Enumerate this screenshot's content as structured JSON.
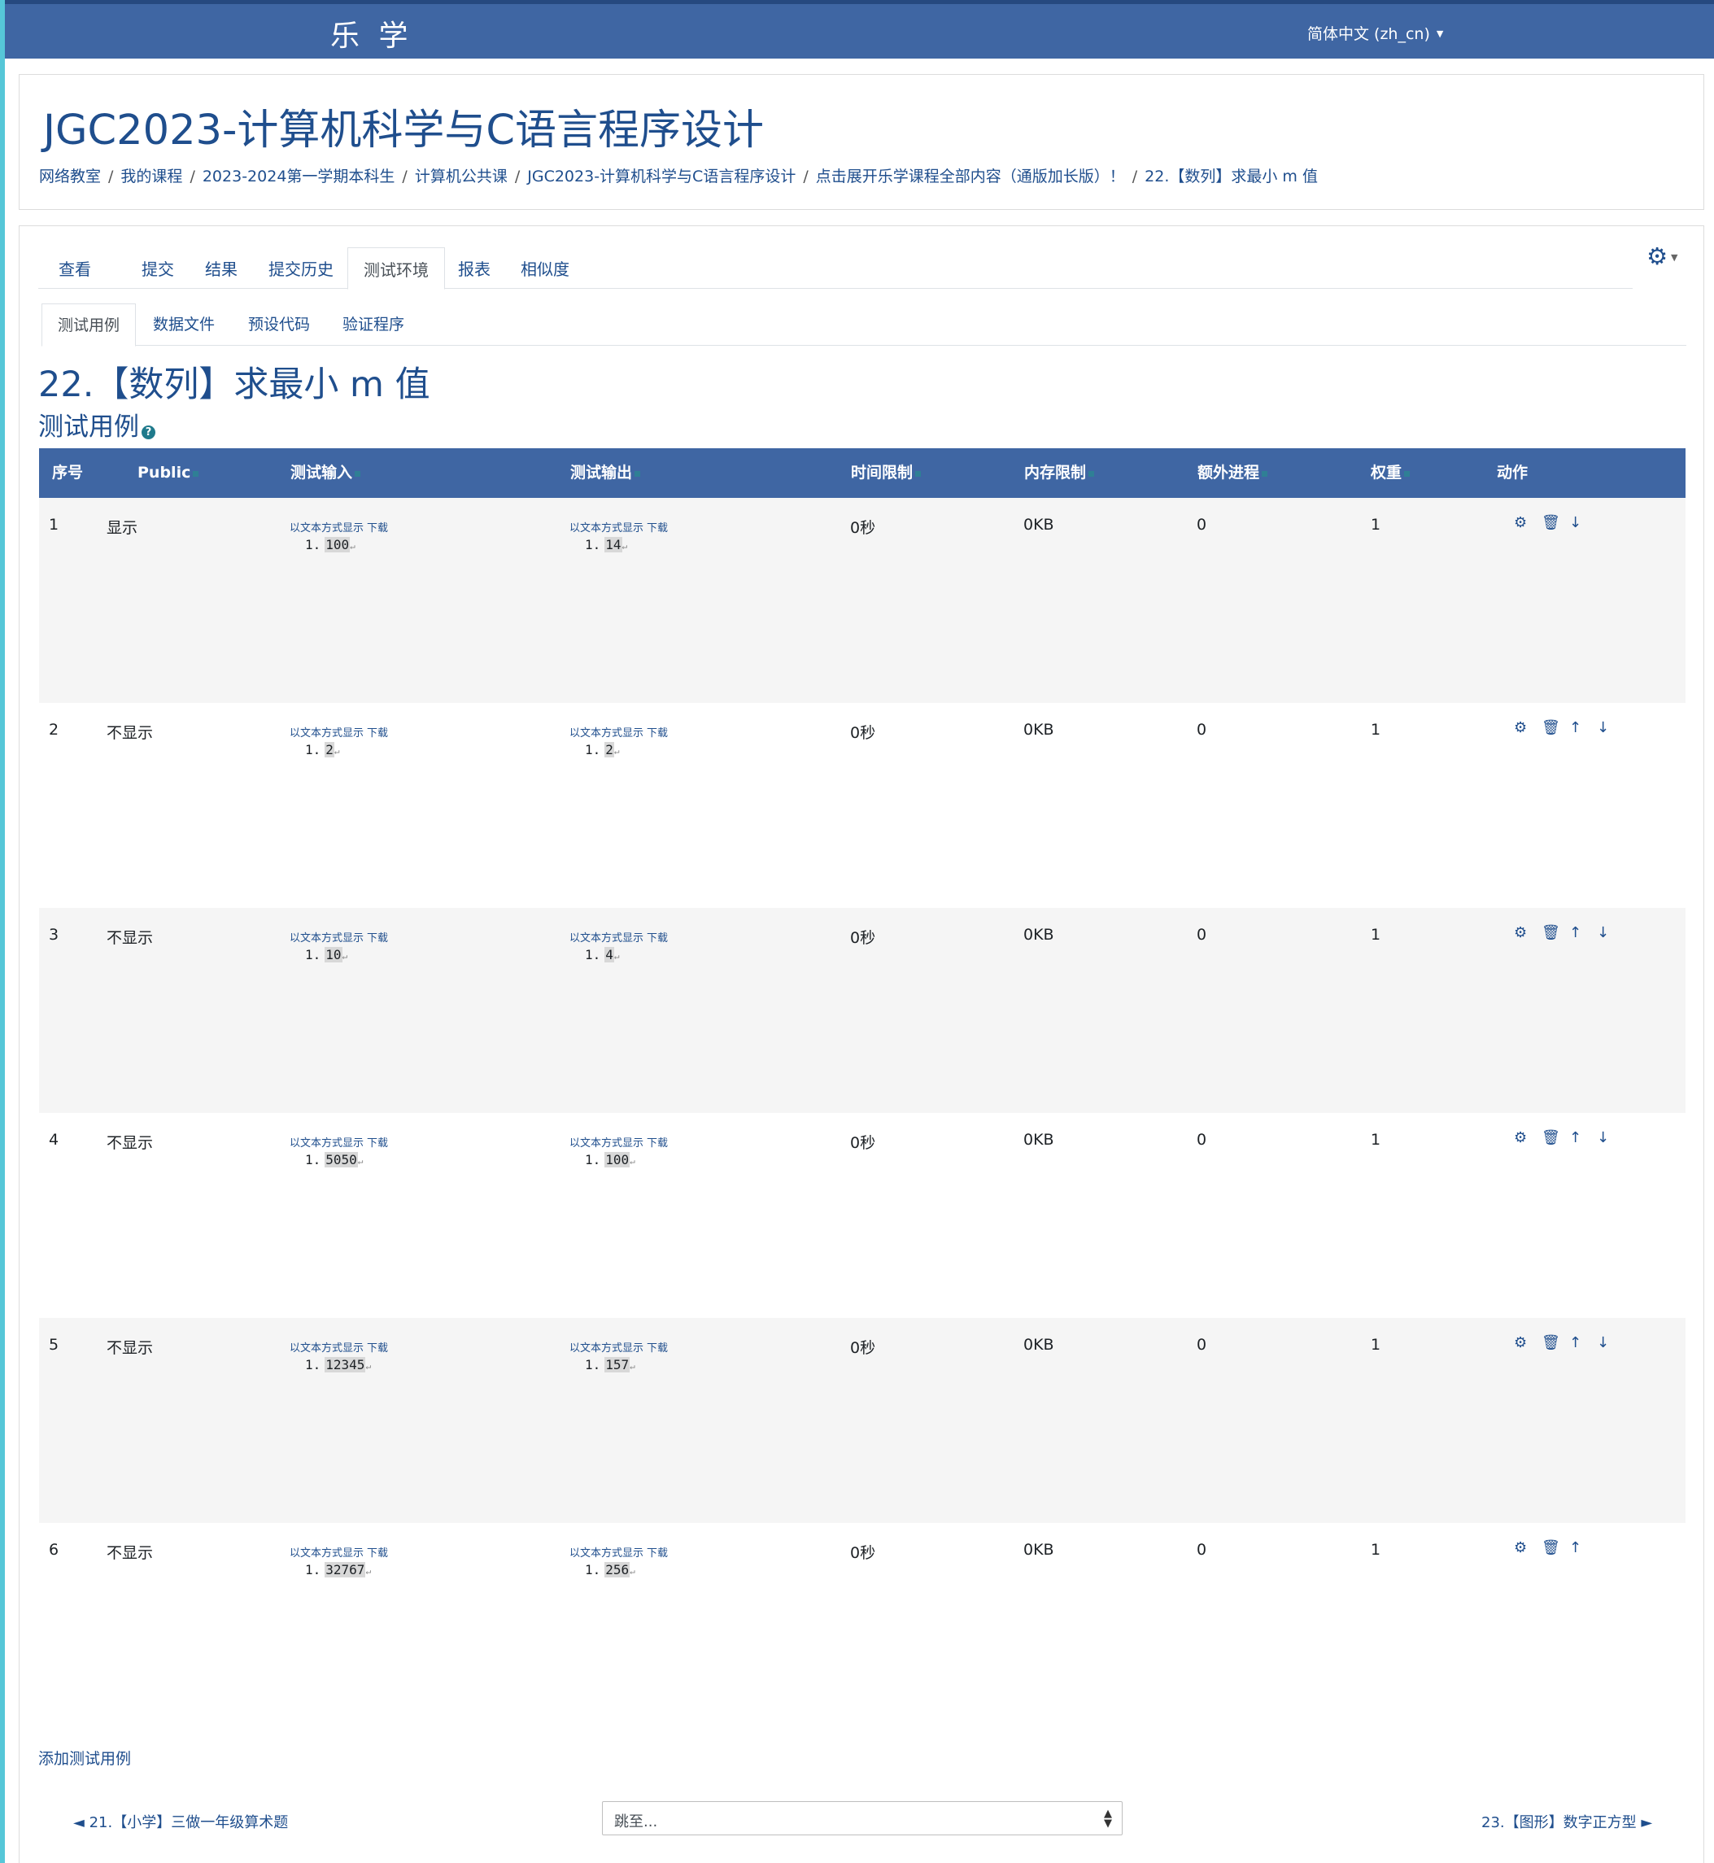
{
  "topbar": {
    "brand": "乐 学",
    "language": "简体中文 (zh_cn)"
  },
  "header": {
    "course_title": "JGC2023-计算机科学与C语言程序设计",
    "breadcrumb": [
      "网络教室",
      "我的课程",
      "2023-2024第一学期本科生",
      "计算机公共课",
      "JGC2023-计算机科学与C语言程序设计",
      "点击展开乐学课程全部内容（通版加长版）！",
      "22.【数列】求最小 m 值"
    ]
  },
  "tabs": [
    "查看",
    "提交",
    "结果",
    "提交历史",
    "测试环境",
    "报表",
    "相似度"
  ],
  "active_tab": "测试环境",
  "subtabs": [
    "测试用例",
    "数据文件",
    "预设代码",
    "验证程序"
  ],
  "active_subtab": "测试用例",
  "problem_title": "22.【数列】求最小 m 值",
  "section_title": "测试用例",
  "table": {
    "headers": [
      "序号",
      "Public",
      "测试输入",
      "测试输出",
      "时间限制",
      "内存限制",
      "额外进程",
      "权重",
      "动作"
    ],
    "io_link_text": "以文本方式显示",
    "io_download_text": "下载",
    "rows": [
      {
        "idx": "1",
        "public": "显示",
        "input": "100",
        "output": "14",
        "time": "0秒",
        "mem": "0KB",
        "extra": "0",
        "weight": "1",
        "actions": [
          "gear-icon",
          "trash-icon",
          "arrow-down-icon"
        ]
      },
      {
        "idx": "2",
        "public": "不显示",
        "input": "2",
        "output": "2",
        "time": "0秒",
        "mem": "0KB",
        "extra": "0",
        "weight": "1",
        "actions": [
          "gear-icon",
          "trash-icon",
          "arrow-up-icon",
          "arrow-down-icon"
        ]
      },
      {
        "idx": "3",
        "public": "不显示",
        "input": "10",
        "output": "4",
        "time": "0秒",
        "mem": "0KB",
        "extra": "0",
        "weight": "1",
        "actions": [
          "gear-icon",
          "trash-icon",
          "arrow-up-icon",
          "arrow-down-icon"
        ]
      },
      {
        "idx": "4",
        "public": "不显示",
        "input": "5050",
        "output": "100",
        "time": "0秒",
        "mem": "0KB",
        "extra": "0",
        "weight": "1",
        "actions": [
          "gear-icon",
          "trash-icon",
          "arrow-up-icon",
          "arrow-down-icon"
        ]
      },
      {
        "idx": "5",
        "public": "不显示",
        "input": "12345",
        "output": "157",
        "time": "0秒",
        "mem": "0KB",
        "extra": "0",
        "weight": "1",
        "actions": [
          "gear-icon",
          "trash-icon",
          "arrow-up-icon",
          "arrow-down-icon"
        ]
      },
      {
        "idx": "6",
        "public": "不显示",
        "input": "32767",
        "output": "256",
        "time": "0秒",
        "mem": "0KB",
        "extra": "0",
        "weight": "1",
        "actions": [
          "gear-icon",
          "trash-icon",
          "arrow-up-icon"
        ]
      }
    ]
  },
  "add_testcase": "添加测试用例",
  "nav": {
    "prev": "◄ 21.【小学】三做一年级算术题",
    "jump_placeholder": "跳至...",
    "next": "23.【图形】数字正方型 ►"
  },
  "colors": {
    "header_bg": "#3f66a3",
    "link": "#1f4e8d",
    "left_strip": "#56c7d8"
  }
}
